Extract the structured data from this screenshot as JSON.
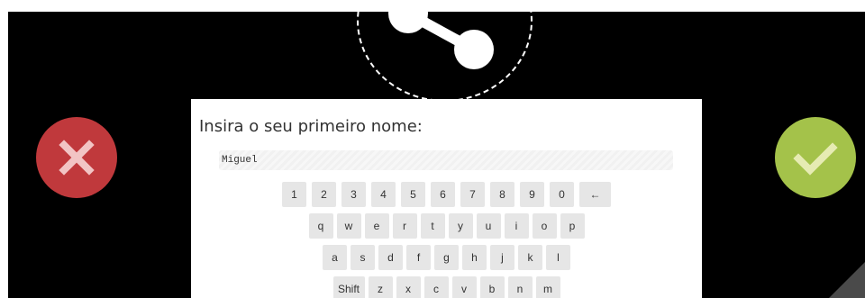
{
  "icons": {
    "share": "share-icon",
    "cancel": "close-icon",
    "confirm": "check-icon"
  },
  "colors": {
    "background": "#000000",
    "cancel": "#c0393c",
    "confirm": "#a4c24a",
    "key": "#e6e6e6"
  },
  "form": {
    "prompt": "Insira o seu primeiro nome:",
    "name_value": "Miguel"
  },
  "keyboard": {
    "rows": [
      [
        "1",
        "2",
        "3",
        "4",
        "5",
        "6",
        "7",
        "8",
        "9",
        "0",
        "←"
      ],
      [
        "q",
        "w",
        "e",
        "r",
        "t",
        "y",
        "u",
        "i",
        "o",
        "p"
      ],
      [
        "a",
        "s",
        "d",
        "f",
        "g",
        "h",
        "j",
        "k",
        "l"
      ],
      [
        "Shift",
        "z",
        "x",
        "c",
        "v",
        "b",
        "n",
        "m"
      ]
    ]
  }
}
